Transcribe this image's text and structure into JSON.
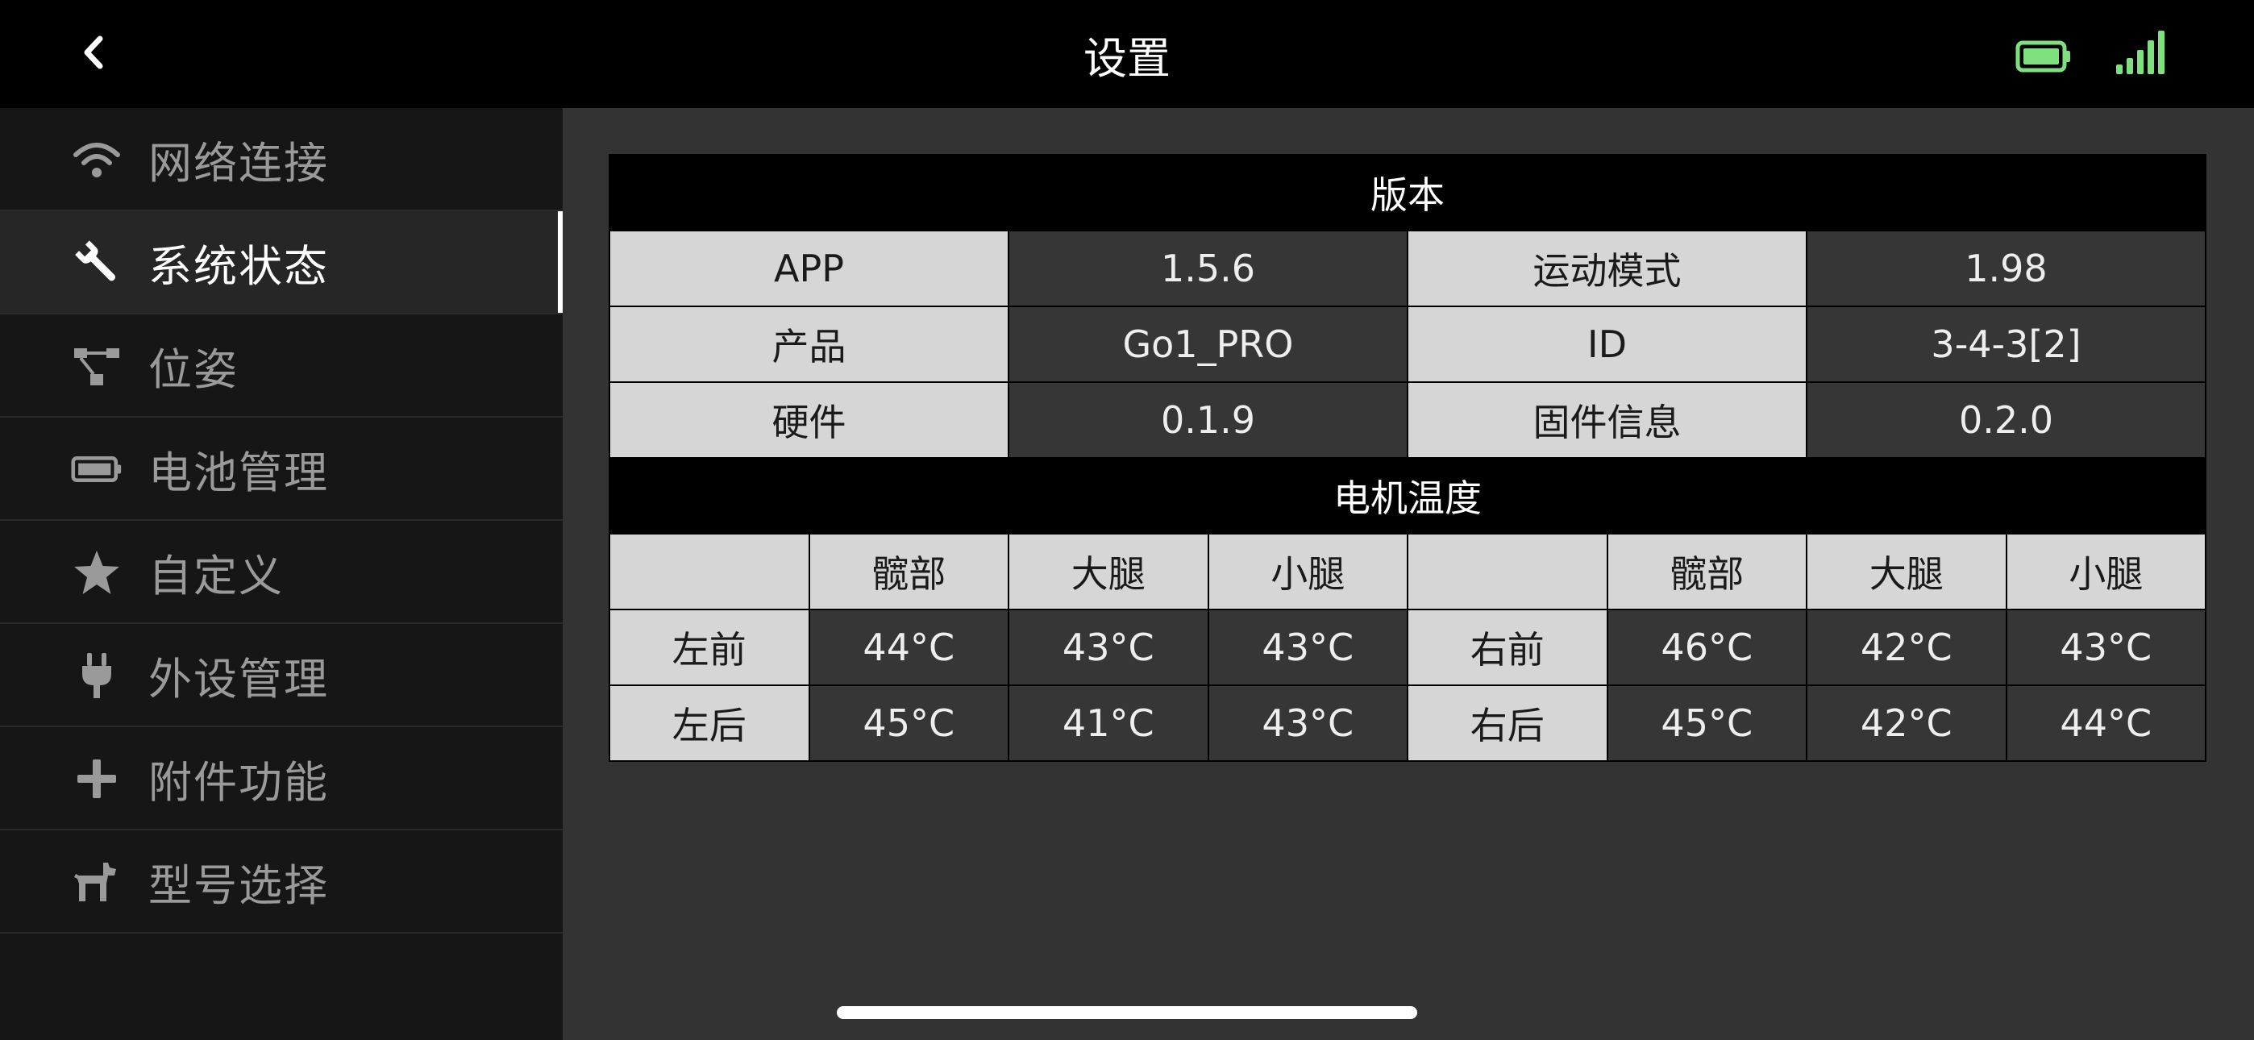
{
  "header": {
    "title": "设置",
    "back_icon": "chevron-left-icon",
    "battery_color": "#7ee07e",
    "signal_color": "#7ee07e"
  },
  "sidebar": {
    "items": [
      {
        "label": "网络连接",
        "icon": "wifi-icon",
        "active": false
      },
      {
        "label": "系统状态",
        "icon": "wrench-icon",
        "active": true
      },
      {
        "label": "位姿",
        "icon": "hierarchy-icon",
        "active": false
      },
      {
        "label": "电池管理",
        "icon": "battery-icon",
        "active": false
      },
      {
        "label": "自定义",
        "icon": "star-icon",
        "active": false
      },
      {
        "label": "外设管理",
        "icon": "plug-icon",
        "active": false
      },
      {
        "label": "附件功能",
        "icon": "plus-icon",
        "active": false
      },
      {
        "label": "型号选择",
        "icon": "dog-icon",
        "active": false
      }
    ]
  },
  "main": {
    "version": {
      "header": "版本",
      "rows": [
        {
          "label1": "APP",
          "value1": "1.5.6",
          "label2": "运动模式",
          "value2": "1.98"
        },
        {
          "label1": "产品",
          "value1": "Go1_PRO",
          "label2": "ID",
          "value2": "3-4-3[2]"
        },
        {
          "label1": "硬件",
          "value1": "0.1.9",
          "label2": "固件信息",
          "value2": "0.2.0"
        }
      ]
    },
    "motor_temp": {
      "header": "电机温度",
      "columns": [
        "髋部",
        "大腿",
        "小腿"
      ],
      "rows": [
        {
          "left_label": "左前",
          "left": [
            "44°C",
            "43°C",
            "43°C"
          ],
          "right_label": "右前",
          "right": [
            "46°C",
            "42°C",
            "43°C"
          ]
        },
        {
          "left_label": "左后",
          "left": [
            "45°C",
            "41°C",
            "43°C"
          ],
          "right_label": "右后",
          "right": [
            "45°C",
            "42°C",
            "44°C"
          ]
        }
      ]
    }
  },
  "colors": {
    "background": "#000000",
    "sidebar_bg": "#161616",
    "sidebar_active_bg": "#262626",
    "panel_bg": "#333333",
    "label_cell_bg": "#d6d6d6",
    "value_cell_bg": "#363636",
    "accent_green": "#7ee07e"
  }
}
